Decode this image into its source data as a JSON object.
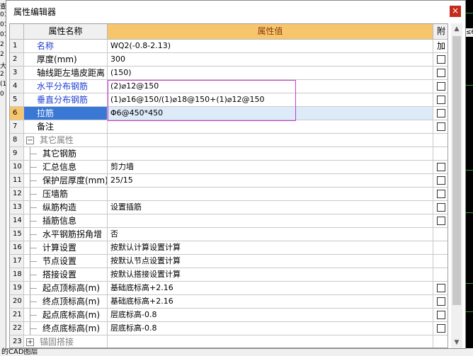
{
  "window": {
    "title": "属性编辑器",
    "close_glyph": "×"
  },
  "background": {
    "left_fragments": [
      "查",
      "01",
      "01",
      "01",
      "2",
      "2",
      "大",
      "2",
      "(1",
      "0"
    ],
    "right_fragment": "≤6",
    "bottom_text": "的CAD图层"
  },
  "columns": {
    "number": "",
    "name": "属性名称",
    "value": "属性值",
    "add": "附加"
  },
  "rows": [
    {
      "num": "1",
      "name": "名称",
      "value": "WQ2(-0.8-2.13)",
      "style": "blue",
      "checkbox": false
    },
    {
      "num": "2",
      "name": "厚度(mm)",
      "value": "300",
      "style": "normal",
      "checkbox": true
    },
    {
      "num": "3",
      "name": "轴线距左墙皮距离",
      "value": "(150)",
      "style": "normal",
      "checkbox": true
    },
    {
      "num": "4",
      "name": "水平分布钢筋",
      "value": "(2)⌀12@150",
      "style": "blue",
      "checkbox": true
    },
    {
      "num": "5",
      "name": "垂直分布钢筋",
      "value": "(1)⌀16@150/(1)⌀18@150+(1)⌀12@150",
      "style": "blue",
      "checkbox": true
    },
    {
      "num": "6",
      "name": "拉筋",
      "value": "Φ6@450*450",
      "style": "normal",
      "checkbox": true,
      "selected": true
    },
    {
      "num": "7",
      "name": "备注",
      "value": "",
      "style": "normal",
      "checkbox": true
    },
    {
      "num": "8",
      "name": "其它属性",
      "value": "",
      "style": "group",
      "toggle": "−",
      "checkbox": false
    },
    {
      "num": "9",
      "name": "其它钢筋",
      "value": "",
      "style": "sub",
      "checkbox": false
    },
    {
      "num": "10",
      "name": "汇总信息",
      "value": "剪力墙",
      "style": "sub",
      "checkbox": true
    },
    {
      "num": "11",
      "name": "保护层厚度(mm)",
      "value": "25/15",
      "style": "sub",
      "checkbox": true
    },
    {
      "num": "12",
      "name": "压墙筋",
      "value": "",
      "style": "sub",
      "checkbox": true
    },
    {
      "num": "13",
      "name": "纵筋构造",
      "value": "设置插筋",
      "style": "sub",
      "checkbox": true
    },
    {
      "num": "14",
      "name": "插筋信息",
      "value": "",
      "style": "sub",
      "checkbox": true
    },
    {
      "num": "15",
      "name": "水平钢筋拐角增",
      "value": "否",
      "style": "sub",
      "checkbox": false
    },
    {
      "num": "16",
      "name": "计算设置",
      "value": "按默认计算设置计算",
      "style": "sub",
      "checkbox": false
    },
    {
      "num": "17",
      "name": "节点设置",
      "value": "按默认节点设置计算",
      "style": "sub",
      "checkbox": false
    },
    {
      "num": "18",
      "name": "搭接设置",
      "value": "按默认搭接设置计算",
      "style": "sub",
      "checkbox": false
    },
    {
      "num": "19",
      "name": "起点顶标高(m)",
      "value": "基础底标高+2.16",
      "style": "sub",
      "checkbox": true
    },
    {
      "num": "20",
      "name": "终点顶标高(m)",
      "value": "基础底标高+2.16",
      "style": "sub",
      "checkbox": true
    },
    {
      "num": "21",
      "name": "起点底标高(m)",
      "value": "层底标高-0.8",
      "style": "sub",
      "checkbox": true
    },
    {
      "num": "22",
      "name": "终点底标高(m)",
      "value": "层底标高-0.8",
      "style": "sub",
      "checkbox": true
    },
    {
      "num": "23",
      "name": "锚固搭接",
      "value": "",
      "style": "group",
      "toggle": "+",
      "checkbox": false
    }
  ],
  "colors": {
    "header_value_bg": "#f7c66c",
    "selected_name_bg": "#3a78d6",
    "selected_value_bg": "#ddeaf8",
    "blue_label": "#1f3fd1",
    "highlight_box": "#c83ad0",
    "close_button": "#c42b1c"
  }
}
